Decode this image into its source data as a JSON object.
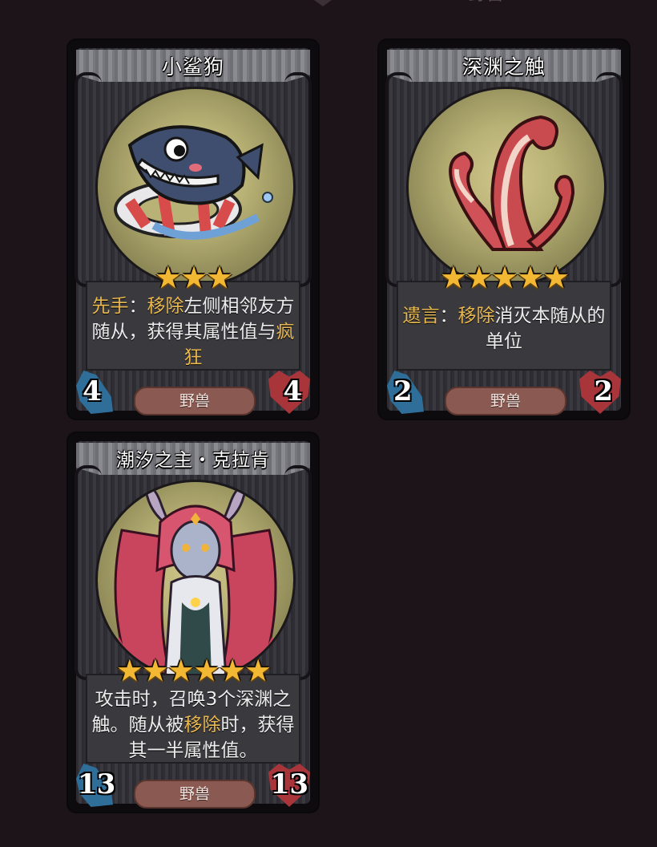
{
  "top_fragment": "野兽",
  "cards": [
    {
      "id": "shark",
      "name": "小鲨狗",
      "stars": "★★★",
      "star_count": 3,
      "desc_parts": [
        "先手",
        "：",
        "移除",
        "左侧相邻友方随从，获得其属性值与",
        "疯狂"
      ],
      "tribe": "野兽",
      "attack": "4",
      "health": "4",
      "art_icon": "shark-in-life-ring-icon"
    },
    {
      "id": "tentacle",
      "name": "深渊之触",
      "stars": "★★★★★",
      "star_count": 5,
      "desc_parts": [
        "遗言",
        "：",
        "移除",
        "消灭本随从的单位"
      ],
      "tribe": "野兽",
      "attack": "2",
      "health": "2",
      "art_icon": "tentacle-icon"
    },
    {
      "id": "kraken",
      "name": "潮汐之主・克拉肯",
      "stars": "★★★★★★",
      "star_count": 6,
      "desc_parts": [
        "攻击时，召唤3个深渊之触。随从被",
        "移除",
        "时，获得其一半属性值。"
      ],
      "tribe": "野兽",
      "attack": "13",
      "health": "13",
      "art_icon": "kraken-portrait-icon"
    }
  ],
  "colors": {
    "background": "#1d141a",
    "keyword": "#e9b74f",
    "star": "#f2b833",
    "attack_badge": "#2e6e98",
    "health_badge": "#a8353a",
    "tribe_pill": "#8a5a52"
  }
}
